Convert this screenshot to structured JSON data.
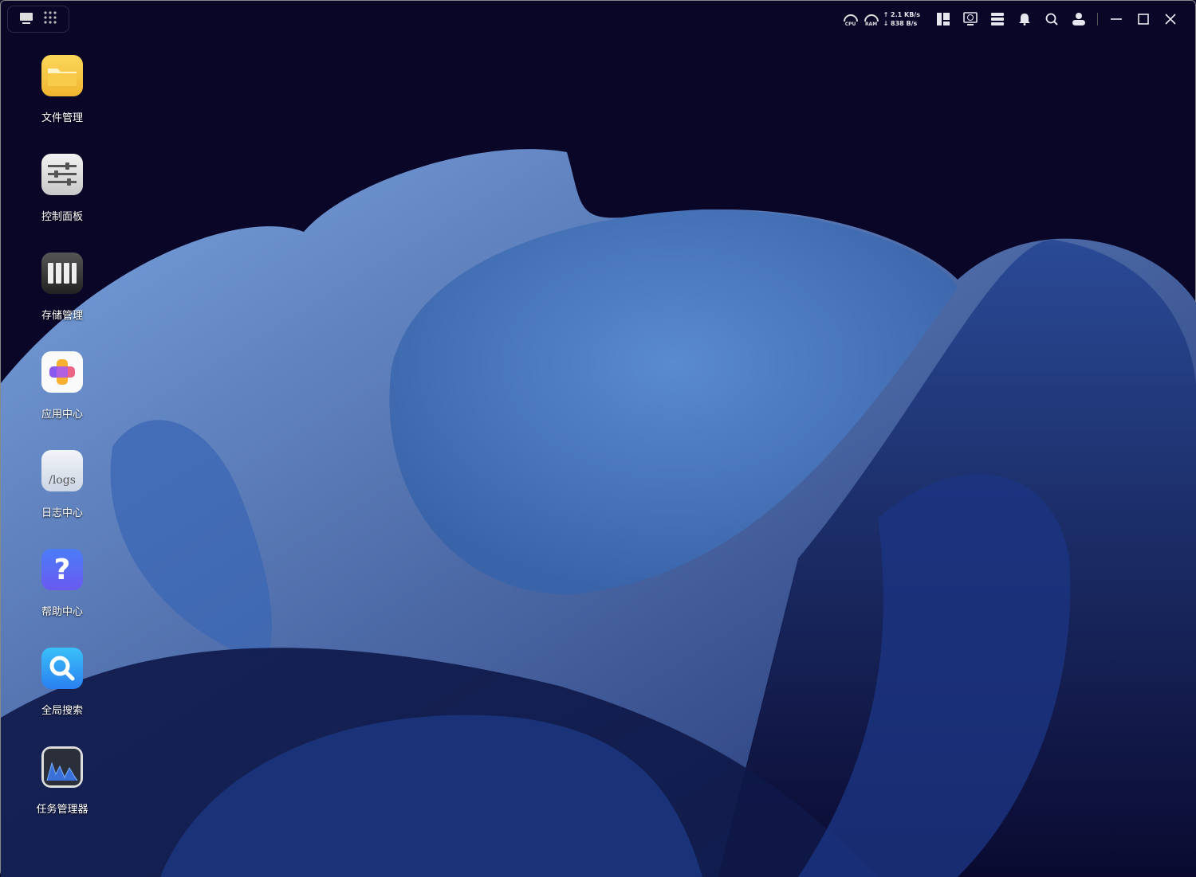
{
  "topleft": {
    "desktop_icon": "desktop-icon",
    "apps_icon": "grid-icon"
  },
  "status": {
    "cpu_label": "CPU",
    "ram_label": "RAM",
    "upload": "↑ 2.1 KB/s",
    "download": "↓ 838 B/s"
  },
  "desktop_apps": [
    {
      "label": "文件管理",
      "icon": "folder-icon"
    },
    {
      "label": "控制面板",
      "icon": "sliders-icon"
    },
    {
      "label": "存储管理",
      "icon": "storage-icon"
    },
    {
      "label": "应用中心",
      "icon": "app-center-icon"
    },
    {
      "label": "日志中心",
      "icon": "logs-icon",
      "icon_text": "/logs"
    },
    {
      "label": "帮助中心",
      "icon": "help-icon",
      "icon_text": "?"
    },
    {
      "label": "全局搜索",
      "icon": "search-icon"
    },
    {
      "label": "任务管理器",
      "icon": "task-manager-icon"
    }
  ]
}
